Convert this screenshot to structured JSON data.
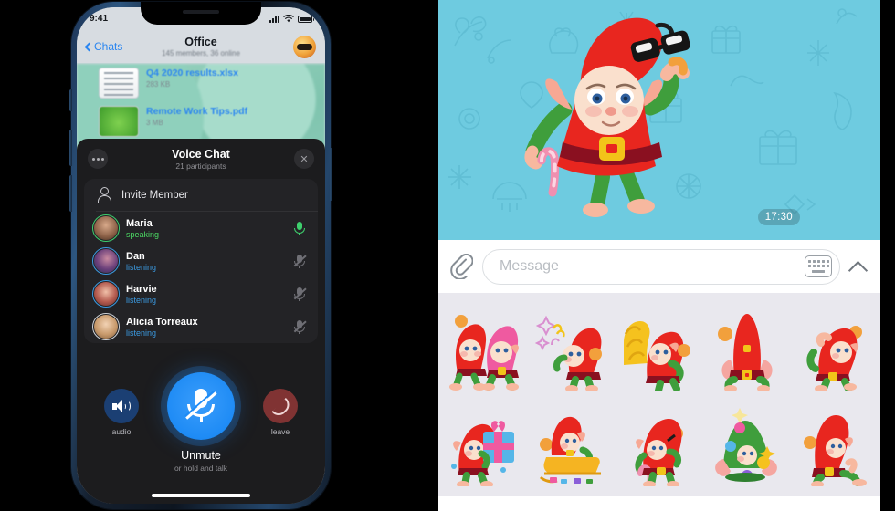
{
  "phone": {
    "statusbar": {
      "time": "9:41",
      "signal_icon": "signal-bars-icon",
      "wifi_icon": "wifi-icon",
      "battery_icon": "battery-icon"
    },
    "navbar": {
      "back_label": "Chats",
      "title": "Office",
      "subtitle": "145 members, 36 online",
      "avatar_icon": "group-avatar"
    },
    "files": [
      {
        "name": "Q4 2020 results.xlsx",
        "size": "283 KB",
        "thumb": "spreadsheet-thumb"
      },
      {
        "name": "Remote Work Tips.pdf",
        "size": "3 MB",
        "thumb": "frog-thumb"
      }
    ],
    "voice_chat": {
      "title": "Voice Chat",
      "subtitle": "21 participants",
      "menu_icon": "more-options-icon",
      "close_icon": "close-icon",
      "invite_label": "Invite Member",
      "invite_icon": "add-person-icon",
      "participants": [
        {
          "name": "Maria",
          "status": "speaking",
          "status_color": "#4cd964",
          "mic_icon": "mic-active-icon",
          "muted": false,
          "ring_color": "#3ecf6d"
        },
        {
          "name": "Dan",
          "status": "listening",
          "status_color": "#3b9ae1",
          "mic_icon": "mic-muted-icon",
          "muted": true,
          "ring_color": "#3b9ae1"
        },
        {
          "name": "Harvie",
          "status": "listening",
          "status_color": "#3b9ae1",
          "mic_icon": "mic-muted-icon",
          "muted": true,
          "ring_color": "#3b9ae1"
        },
        {
          "name": "Alicia Torreaux",
          "status": "listening",
          "status_color": "#3b9ae1",
          "mic_icon": "mic-muted-icon",
          "muted": true,
          "ring_color": "#9aa4ae"
        }
      ],
      "controls": {
        "audio_label": "audio",
        "audio_icon": "speaker-icon",
        "leave_label": "leave",
        "leave_icon": "hangup-icon",
        "main_icon": "mic-muted-icon",
        "main_label": "Unmute",
        "main_hint": "or hold and talk"
      }
    }
  },
  "chat": {
    "background_color": "#6ecbe0",
    "timestamp": "17:30",
    "main_sticker": "elf-with-sunglasses-sticker",
    "composer": {
      "attach_icon": "paperclip-icon",
      "placeholder": "Message",
      "value": "",
      "keyboard_icon": "keyboard-icon",
      "expand_icon": "chevron-up-icon"
    },
    "sticker_panel": {
      "background_color": "#e9e8ee",
      "stickers": [
        "two-elves-hugging-sticker",
        "elf-with-sparkles-sticker",
        "elf-with-big-hand-sticker",
        "elf-tall-hat-sticker",
        "elf-waving-sticker",
        "elf-carrying-gift-sticker",
        "elf-in-sleigh-sticker",
        "elf-with-candy-cane-sticker",
        "elf-christmas-tree-sticker",
        "elf-sitting-sticker"
      ]
    }
  }
}
